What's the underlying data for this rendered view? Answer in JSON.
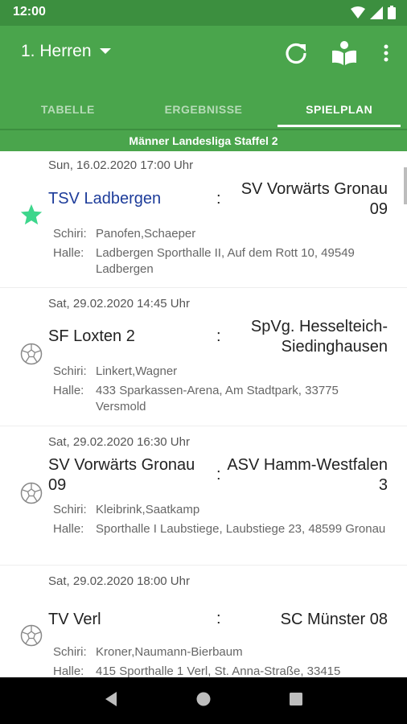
{
  "status": {
    "time": "12:00"
  },
  "appbar": {
    "team": "1. Herren"
  },
  "tabs": [
    {
      "label": "TABELLE",
      "active": false
    },
    {
      "label": "ERGEBNISSE",
      "active": false
    },
    {
      "label": "SPIELPLAN",
      "active": true
    }
  ],
  "league": "Männer Landesliga Staffel 2",
  "labels": {
    "referee": "Schiri:",
    "hall": "Halle:"
  },
  "matches": [
    {
      "date": "Sun, 16.02.2020 17:00 Uhr",
      "home": "TSV Ladbergen",
      "away": "SV Vorwärts Gronau 09",
      "referees": "Panofen,Schaeper",
      "hall": "Ladbergen Sporthalle II, Auf dem Rott 10, 49549 Ladbergen",
      "icon": "star-icon"
    },
    {
      "date": "Sat, 29.02.2020 14:45 Uhr",
      "home": "SF Loxten 2",
      "away": "SpVg. Hesselteich-Siedinghausen",
      "referees": "Linkert,Wagner",
      "hall": "433 Sparkassen-Arena, Am Stadtpark, 33775 Versmold",
      "icon": "ball-icon"
    },
    {
      "date": "Sat, 29.02.2020 16:30 Uhr",
      "home": "SV Vorwärts Gronau 09",
      "away": "ASV Hamm-Westfalen 3",
      "referees": "Kleibrink,Saatkamp",
      "hall": "Sporthalle I Laubstiege, Laubstiege 23, 48599 Gronau",
      "icon": "ball-icon"
    },
    {
      "date": "Sat, 29.02.2020 18:00 Uhr",
      "home": "TV Verl",
      "away": "SC Münster 08",
      "referees": "Kroner,Naumann-Bierbaum",
      "hall": "415 Sporthalle 1 Verl, St. Anna-Straße, 33415",
      "icon": "ball-icon"
    }
  ],
  "colors": {
    "primary": "#4aa54c",
    "status": "#3c8f3f",
    "favorite_star": "#3dd68c",
    "favorite_team": "#1d3c9a"
  }
}
